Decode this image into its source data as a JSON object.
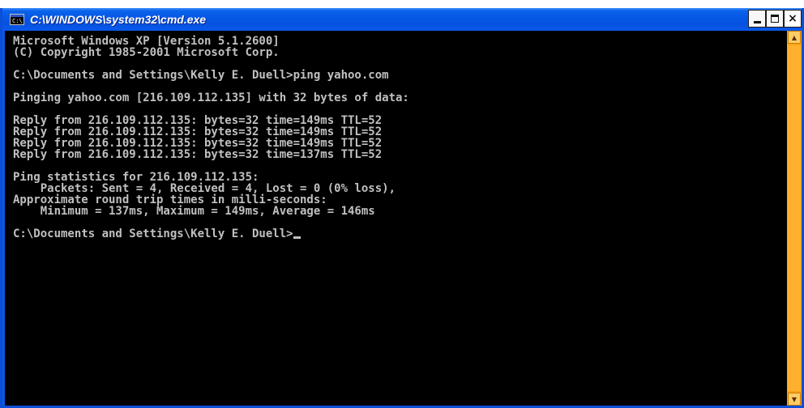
{
  "window": {
    "title": "C:\\WINDOWS\\system32\\cmd.exe",
    "icon": "cmd-icon",
    "buttons": {
      "minimize": "minimize-icon",
      "maximize": "maximize-icon",
      "close_label": "×"
    }
  },
  "console": {
    "lines": [
      "Microsoft Windows XP [Version 5.1.2600]",
      "(C) Copyright 1985-2001 Microsoft Corp.",
      "",
      "C:\\Documents and Settings\\Kelly E. Duell>ping yahoo.com",
      "",
      "Pinging yahoo.com [216.109.112.135] with 32 bytes of data:",
      "",
      "Reply from 216.109.112.135: bytes=32 time=149ms TTL=52",
      "Reply from 216.109.112.135: bytes=32 time=149ms TTL=52",
      "Reply from 216.109.112.135: bytes=32 time=149ms TTL=52",
      "Reply from 216.109.112.135: bytes=32 time=137ms TTL=52",
      "",
      "Ping statistics for 216.109.112.135:",
      "    Packets: Sent = 4, Received = 4, Lost = 0 (0% loss),",
      "Approximate round trip times in milli-seconds:",
      "    Minimum = 137ms, Maximum = 149ms, Average = 146ms",
      "",
      "C:\\Documents and Settings\\Kelly E. Duell>"
    ]
  },
  "scrollbar": {
    "up_icon": "scroll-up-arrow-icon",
    "down_icon": "scroll-down-arrow-icon"
  },
  "colors": {
    "titlebar": "#0656e6",
    "console_bg": "#000000",
    "console_text": "#c0c0c0",
    "scrollbar": "#ffa319"
  }
}
